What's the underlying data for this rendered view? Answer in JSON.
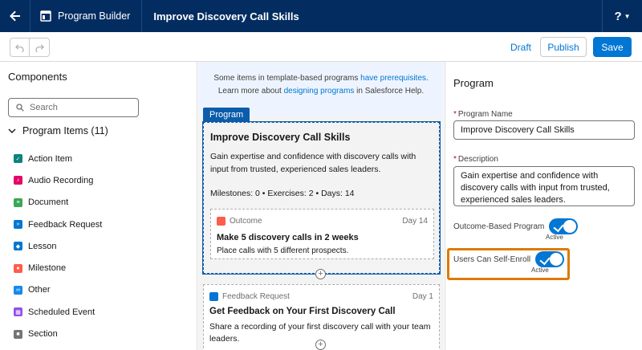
{
  "header": {
    "app_name": "Program Builder",
    "program_title": "Improve Discovery Call Skills",
    "help_label": "?"
  },
  "toolbar": {
    "draft_label": "Draft",
    "publish_label": "Publish",
    "save_label": "Save"
  },
  "components": {
    "title": "Components",
    "search_placeholder": "Search",
    "group_label": "Program Items (11)",
    "items": [
      {
        "label": "Action Item",
        "color": "#0b827c"
      },
      {
        "label": "Audio Recording",
        "color": "#e3066a"
      },
      {
        "label": "Document",
        "color": "#3ba755"
      },
      {
        "label": "Feedback Request",
        "color": "#0176d3"
      },
      {
        "label": "Lesson",
        "color": "#0176d3"
      },
      {
        "label": "Milestone",
        "color": "#fe5c4c"
      },
      {
        "label": "Other",
        "color": "#1589ee"
      },
      {
        "label": "Scheduled Event",
        "color": "#9050e9"
      },
      {
        "label": "Section",
        "color": "#747474"
      }
    ]
  },
  "canvas": {
    "notice_part1": "Some items in template-based programs ",
    "notice_link1": "have prerequisites",
    "notice_part2": ".",
    "notice_part3": "Learn more about ",
    "notice_link2": "designing programs",
    "notice_part4": " in Salesforce Help.",
    "program_tab": "Program",
    "program": {
      "title": "Improve Discovery Call Skills",
      "description": "Gain expertise and confidence with discovery calls with input from trusted, experienced sales leaders.",
      "meta": "Milestones: 0 • Exercises: 2 • Days: 14"
    },
    "outcome": {
      "type": "Outcome",
      "day": "Day 14",
      "title": "Make 5 discovery calls in 2 weeks",
      "subtitle": "Place calls with 5 different prospects."
    },
    "feedback": {
      "type": "Feedback Request",
      "day": "Day 1",
      "title": "Get Feedback on Your First Discovery Call",
      "subtitle": "Share a recording of your first discovery call with your team leaders."
    }
  },
  "properties": {
    "title": "Program",
    "name_label": "Program Name",
    "name_value": "Improve Discovery Call Skills",
    "description_label": "Description",
    "description_value": "Gain expertise and confidence with discovery calls with input from trusted, experienced sales leaders.",
    "outcome_toggle_label": "Outcome-Based Program",
    "outcome_toggle_state": "Active",
    "self_enroll_label": "Users Can Self-Enroll",
    "self_enroll_state": "Active"
  }
}
